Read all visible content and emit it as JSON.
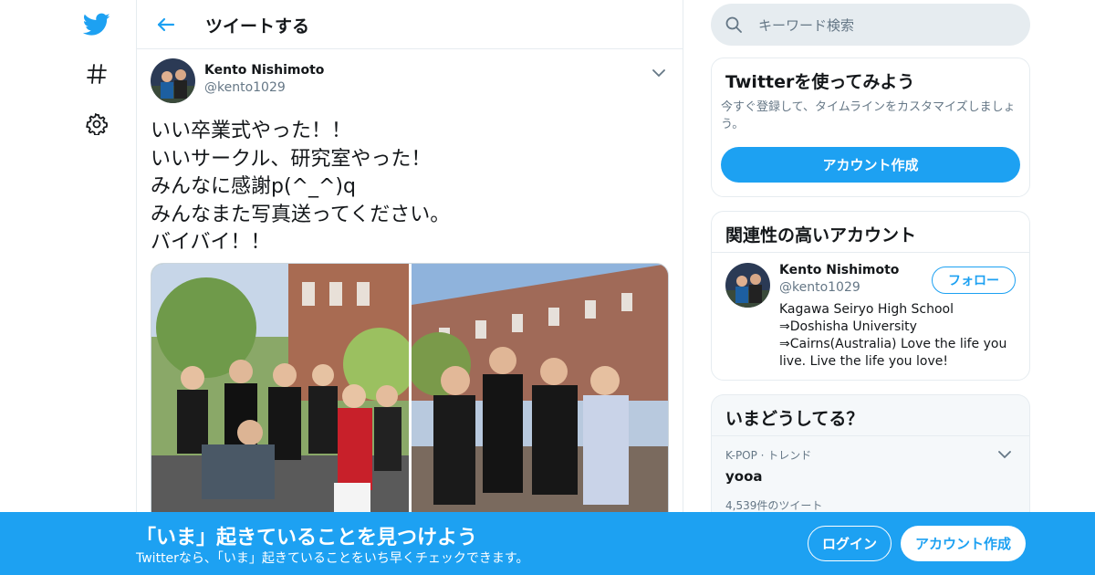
{
  "colors": {
    "accent": "#1da1f2",
    "text": "#14171a",
    "muted": "#657786",
    "border": "#e6ecf0"
  },
  "nav": {
    "icons": [
      "twitter-bird-icon",
      "hashtag-icon",
      "settings-icon"
    ]
  },
  "header": {
    "back_icon": "arrow-left-icon",
    "title": "ツイートする"
  },
  "tweet": {
    "author_name": "Kento Nishimoto",
    "author_handle": "@kento1029",
    "text_lines": [
      "いい卒業式やった！！",
      "いいサークル、研究室やった！",
      "みんなに感謝p(^_^)q",
      "みんなまた写真送ってください。",
      "バイバイ！！"
    ],
    "media": [
      "group-photo-1",
      "group-photo-2"
    ]
  },
  "search": {
    "placeholder": "キーワード検索"
  },
  "try_card": {
    "title": "Twitterを使ってみよう",
    "description": "今すぐ登録して、タイムラインをカスタマイズしましょう。",
    "button": "アカウント作成"
  },
  "related_card": {
    "title": "関連性の高いアカウント",
    "account": {
      "name": "Kento Nishimoto",
      "handle": "@kento1029",
      "follow_label": "フォロー",
      "bio": "Kagawa Seiryo High School ⇒Doshisha University ⇒Cairns(Australia) Love the life you live. Live the life you love!"
    }
  },
  "trends_card": {
    "title": "いまどうしてる？",
    "trends": [
      {
        "meta": "K-POP · トレンド",
        "name": "yooa",
        "count": "4,539件のツイート"
      }
    ]
  },
  "banner": {
    "headline": "「いま」起きていることを見つけよう",
    "sub": "Twitterなら、「いま」起きていることをいち早くチェックできます。",
    "login": "ログイン",
    "signup": "アカウント作成"
  }
}
